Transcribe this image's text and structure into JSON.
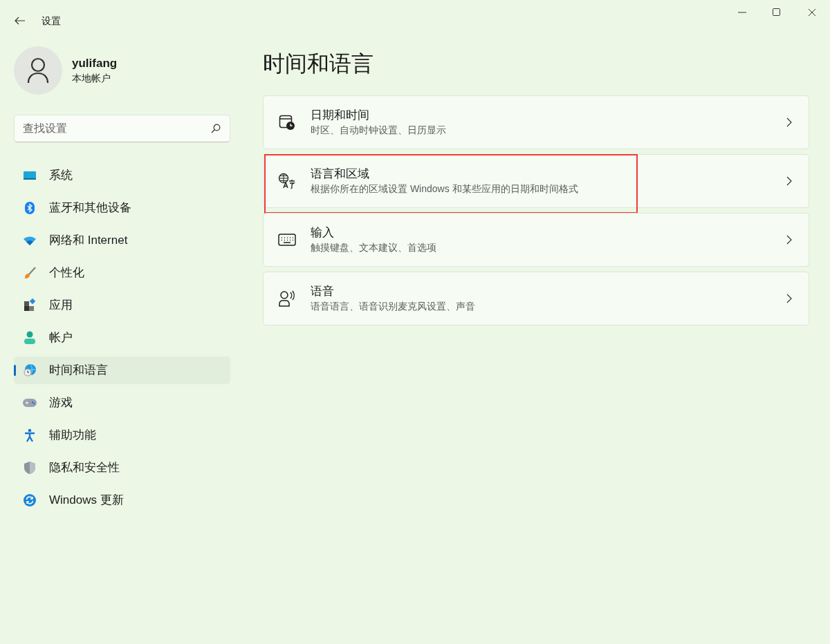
{
  "window": {
    "title": "设置"
  },
  "user": {
    "name": "yulifang",
    "account_type": "本地帐户"
  },
  "search": {
    "placeholder": "查找设置"
  },
  "sidebar": {
    "items": [
      {
        "label": "系统",
        "selected": false
      },
      {
        "label": "蓝牙和其他设备",
        "selected": false
      },
      {
        "label": "网络和 Internet",
        "selected": false
      },
      {
        "label": "个性化",
        "selected": false
      },
      {
        "label": "应用",
        "selected": false
      },
      {
        "label": "帐户",
        "selected": false
      },
      {
        "label": "时间和语言",
        "selected": true
      },
      {
        "label": "游戏",
        "selected": false
      },
      {
        "label": "辅助功能",
        "selected": false
      },
      {
        "label": "隐私和安全性",
        "selected": false
      },
      {
        "label": "Windows 更新",
        "selected": false
      }
    ]
  },
  "page": {
    "title": "时间和语言",
    "cards": [
      {
        "title": "日期和时间",
        "subtitle": "时区、自动时钟设置、日历显示",
        "highlighted": false
      },
      {
        "title": "语言和区域",
        "subtitle": "根据你所在的区域设置 Windows 和某些应用的日期和时间格式",
        "highlighted": true
      },
      {
        "title": "输入",
        "subtitle": "触摸键盘、文本建议、首选项",
        "highlighted": false
      },
      {
        "title": "语音",
        "subtitle": "语音语言、语音识别麦克风设置、声音",
        "highlighted": false
      }
    ]
  }
}
